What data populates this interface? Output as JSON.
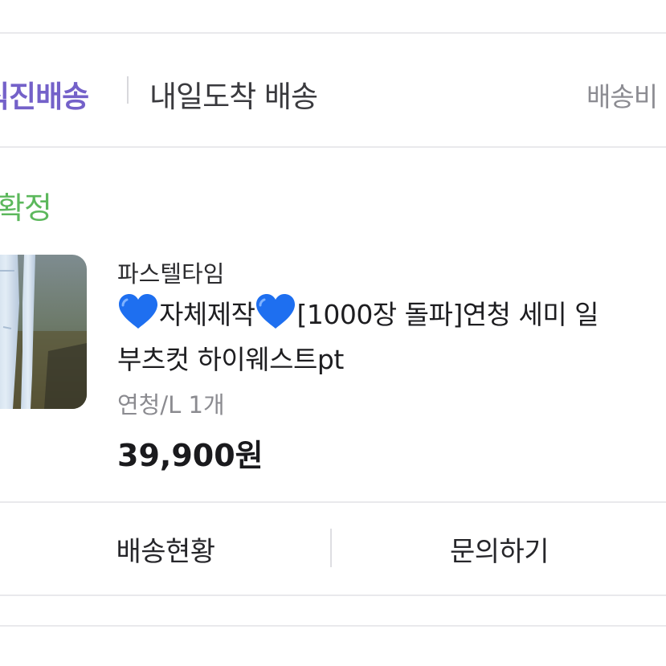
{
  "shipping": {
    "direct_label": "직진배송",
    "tomorrow_label": "내일도착 배송",
    "fee_label": "배송비"
  },
  "order": {
    "status_label": "확정"
  },
  "product": {
    "shop_name": "파스텔타임",
    "title_part1": "자체제작",
    "title_part2": "[1000장 돌파]연청 세미 일",
    "title_line2": "부츠컷 하이웨스트pt",
    "option": "연청/L 1개",
    "price": "39,900원",
    "heart_icon": "blue-heart-icon"
  },
  "actions": {
    "track_label": "배송현황",
    "inquiry_label": "문의하기"
  },
  "colors": {
    "direct_accent": "#7461c9",
    "status_green": "#5cb85c",
    "heart_blue": "#1e6ff0"
  }
}
